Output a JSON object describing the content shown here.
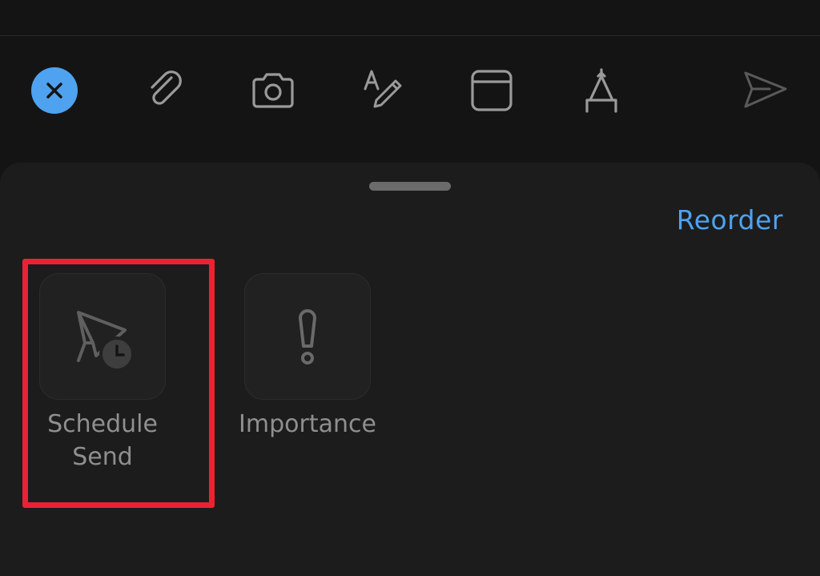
{
  "toolbar": {
    "icons": {
      "close": "close-icon",
      "attach": "paperclip-icon",
      "camera": "camera-icon",
      "format": "text-format-icon",
      "layout": "window-icon",
      "draw": "compass-draw-icon",
      "send": "send-icon"
    },
    "accent_color": "#4ea2f0"
  },
  "sheet": {
    "reorder_label": "Reorder",
    "actions": [
      {
        "label": "Schedule\nSend",
        "icon": "schedule-send-icon"
      },
      {
        "label": "Importance",
        "icon": "exclamation-icon"
      }
    ],
    "highlight_color": "#ec2233"
  }
}
